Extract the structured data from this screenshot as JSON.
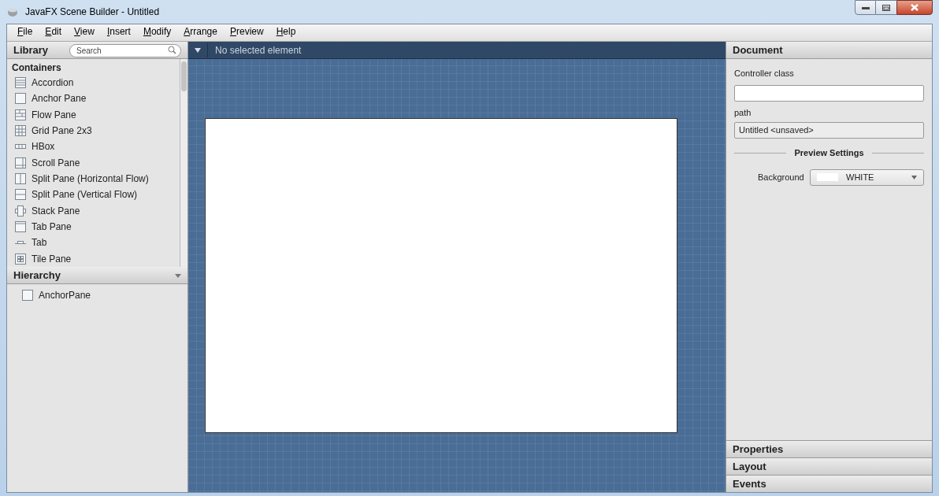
{
  "window": {
    "title": "JavaFX Scene Builder - Untitled"
  },
  "menu": [
    "File",
    "Edit",
    "View",
    "Insert",
    "Modify",
    "Arrange",
    "Preview",
    "Help"
  ],
  "library": {
    "title": "Library",
    "search": {
      "placeholder": "Search"
    },
    "section": "Containers",
    "items": [
      {
        "label": "Accordion",
        "kind": "accordion"
      },
      {
        "label": "Anchor Pane",
        "kind": "box"
      },
      {
        "label": "Flow Pane",
        "kind": "flow"
      },
      {
        "label": "Grid Pane 2x3",
        "kind": "grid"
      },
      {
        "label": "HBox",
        "kind": "hbox"
      },
      {
        "label": "Scroll Pane",
        "kind": "scroll"
      },
      {
        "label": "Split Pane (Horizontal Flow)",
        "kind": "hsplit"
      },
      {
        "label": "Split Pane (Vertical Flow)",
        "kind": "vsplit"
      },
      {
        "label": "Stack Pane",
        "kind": "stack"
      },
      {
        "label": "Tab Pane",
        "kind": "tabpane"
      },
      {
        "label": "Tab",
        "kind": "tab"
      },
      {
        "label": "Tile Pane",
        "kind": "tile"
      }
    ]
  },
  "hierarchy": {
    "title": "Hierarchy",
    "items": [
      {
        "label": "AnchorPane"
      }
    ]
  },
  "canvas": {
    "selection": "No selected element"
  },
  "document": {
    "title": "Document",
    "controller_label": "Controller class",
    "path_label": "path",
    "path_value": "Untitled <unsaved>",
    "preview_title": "Preview Settings",
    "background_label": "Background",
    "background_value": "WHITE"
  },
  "sections": [
    "Properties",
    "Layout",
    "Events"
  ]
}
